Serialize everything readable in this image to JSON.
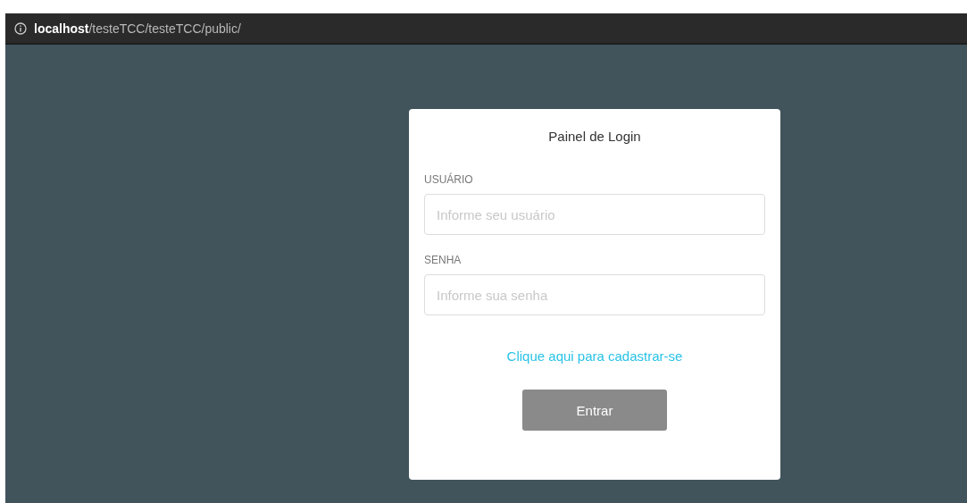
{
  "browser": {
    "url": "**localhost**/testeTCC/testeTCC/public/"
  },
  "login_panel": {
    "title": "Painel de Login",
    "fields": [
      {
        "label": "USUÁRIO",
        "placeholder": "Informe seu usuário"
      },
      {
        "label": "SENHA",
        "placeholder": "Informe sua senha"
      }
    ],
    "register_link": "Clique aqui para cadastrar-se",
    "submit_button": {
      "label": "Entrar",
      "disabled": true
    }
  }
}
